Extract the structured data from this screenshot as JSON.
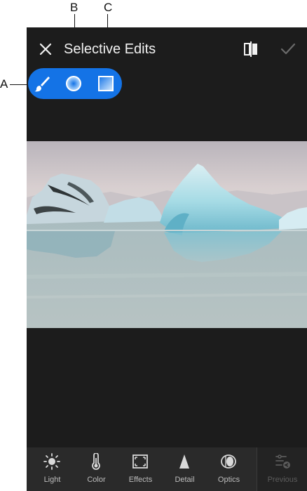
{
  "callouts": {
    "a": "A",
    "b": "B",
    "c": "C"
  },
  "header": {
    "title": "Selective Edits"
  },
  "tools": [
    {
      "id": "brush",
      "icon": "brush-icon"
    },
    {
      "id": "radial",
      "icon": "radial-gradient-icon"
    },
    {
      "id": "linear",
      "icon": "linear-gradient-icon"
    }
  ],
  "bottom_nav": {
    "items": [
      {
        "label": "Light",
        "icon": "sun-icon"
      },
      {
        "label": "Color",
        "icon": "thermometer-icon"
      },
      {
        "label": "Effects",
        "icon": "vignette-icon"
      },
      {
        "label": "Detail",
        "icon": "triangle-icon"
      },
      {
        "label": "Optics",
        "icon": "lens-icon"
      }
    ],
    "previous": {
      "label": "Previous",
      "icon": "sliders-paste-icon"
    }
  },
  "colors": {
    "accent": "#1473e6",
    "background": "#1c1c1c",
    "nav_background": "#2a2a2a"
  }
}
